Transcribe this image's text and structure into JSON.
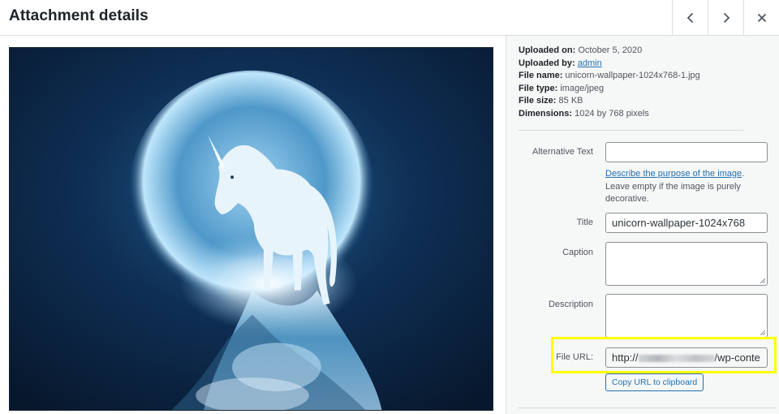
{
  "header": {
    "title": "Attachment details",
    "prev_icon": "chevron-left-icon",
    "next_icon": "chevron-right-icon",
    "close_icon": "close-icon"
  },
  "image": {
    "description_icon": "unicorn-moon-image"
  },
  "details": {
    "uploaded_on_label": "Uploaded on:",
    "uploaded_on": "October 5, 2020",
    "uploaded_by_label": "Uploaded by:",
    "uploaded_by": "admin",
    "file_name_label": "File name:",
    "file_name": "unicorn-wallpaper-1024x768-1.jpg",
    "file_type_label": "File type:",
    "file_type": "image/jpeg",
    "file_size_label": "File size:",
    "file_size": "85 KB",
    "dimensions_label": "Dimensions:",
    "dimensions": "1024 by 768 pixels"
  },
  "form": {
    "alt_label": "Alternative Text",
    "alt_value": "",
    "alt_help_link": "Describe the purpose of the image",
    "alt_help_period": ".",
    "alt_help_text": "Leave empty if the image is purely decorative.",
    "title_label": "Title",
    "title_value": "unicorn-wallpaper-1024x768",
    "caption_label": "Caption",
    "caption_value": "",
    "description_label": "Description",
    "description_value": "",
    "file_url_label": "File URL:",
    "file_url_prefix": "http://",
    "file_url_suffix": "/wp-conte",
    "copy_button": "Copy URL to clipboard"
  },
  "colors": {
    "link": "#2271b1",
    "highlight": "#ffff00",
    "sidebar_bg": "#f6f7f7"
  }
}
